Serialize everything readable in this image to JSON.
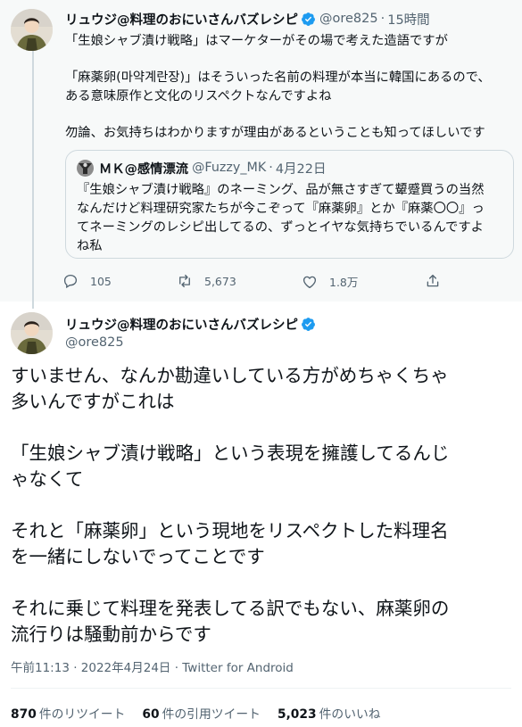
{
  "parent_tweet": {
    "author_name": "リュウジ@料理のおにいさんバズレシピ",
    "author_handle": "@ore825",
    "separator": "·",
    "time": "15時間",
    "text_lines": [
      "「生娘シャブ漬け戦略」はマーケターがその場で考えた造語ですが",
      "",
      "「麻薬卵(마약계란장)」はそういった名前の料理が本当に韓国にあるので、",
      "ある意味原作と文化のリスペクトなんですよね",
      "",
      "勿論、お気持ちはわかりますが理由があるということも知ってほしいです"
    ],
    "quoted": {
      "author_name": "ＭＫ@感情漂流",
      "author_handle": "@Fuzzy_MK",
      "separator": "·",
      "date": "4月22日",
      "text_lines": [
        "『生娘シャブ漬け戦略』のネーミング、品が無さすぎて顰蹙買うの当然",
        "なんだけど料理研究家たちが今こぞって『麻薬卵』とか『麻薬〇〇』っ",
        "てネーミングのレシピ出してるの、ずっとイヤな気持ちでいるんですよ",
        "ね私"
      ]
    },
    "actions": {
      "reply_count": "105",
      "retweet_count": "5,673",
      "like_count": "1.8万"
    },
    "icons": {
      "reply": "reply-icon",
      "retweet": "retweet-icon",
      "like": "like-icon",
      "share": "share-icon",
      "verified": "verified-badge-icon"
    }
  },
  "main_tweet": {
    "author_name": "リュウジ@料理のおにいさんバズレシピ",
    "author_handle": "@ore825",
    "text_lines": [
      "すいません、なんか勘違いしている方がめちゃくちゃ",
      "多いんですがこれは",
      "",
      "「生娘シャブ漬け戦略」という表現を擁護してるんじ",
      "ゃなくて",
      "",
      "それと「麻薬卵」という現地をリスペクトした料理名",
      "を一緒にしないでってことです",
      "",
      "それに乗じて料理を発表してる訳でもない、麻薬卵の",
      "流行りは騒動前からです"
    ],
    "meta": "午前11:13 · 2022年4月24日 · Twitter for Android",
    "stats": {
      "retweets_value": "870",
      "retweets_label": "件のリツイート",
      "quotes_value": "60",
      "quotes_label": "件の引用ツイート",
      "likes_value": "5,023",
      "likes_label": "件のいいね"
    }
  },
  "colors": {
    "verified_blue": "#1d9bf0",
    "secondary_text": "#536471",
    "parent_background": "#f7f9f9",
    "border": "#cfd9de"
  }
}
